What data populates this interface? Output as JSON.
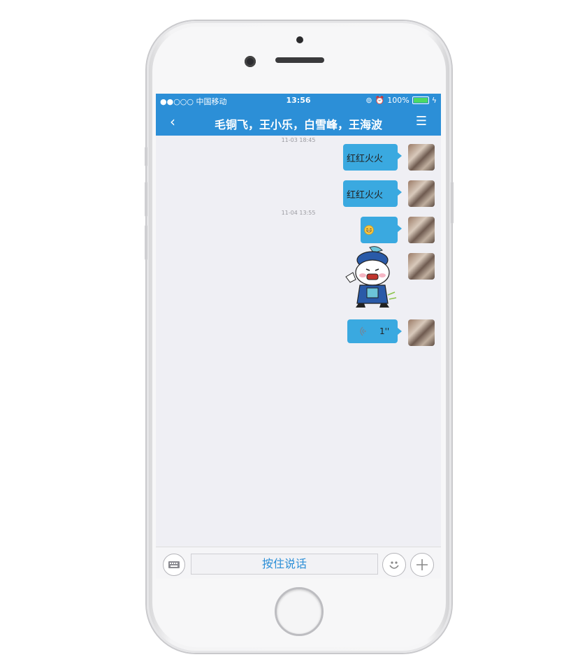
{
  "status_bar": {
    "carrier": "●●○○○ 中国移动",
    "time": "13:56",
    "battery": "100%"
  },
  "nav": {
    "title": "毛铜飞，王小乐，白雪峰，王海波",
    "back_icon": "chevron-left-icon",
    "menu_icon": "menu-icon"
  },
  "timestamps": [
    "11-03 18:45",
    "11-04 13:55"
  ],
  "messages": [
    {
      "type": "text",
      "text": "红红火火"
    },
    {
      "type": "text",
      "text": "红红火火"
    },
    {
      "type": "emoji",
      "icon": "grin-emoji-icon"
    },
    {
      "type": "sticker",
      "icon": "cartoon-official-sticker"
    },
    {
      "type": "voice",
      "duration": "1''"
    }
  ],
  "input_bar": {
    "talk_label": "按住说话",
    "keyboard_icon": "keyboard-icon",
    "emoji_icon": "smiley-icon",
    "plus_icon": "plus-icon"
  },
  "colors": {
    "accent": "#2c8fd7",
    "bubble": "#3aa9e0",
    "background": "#efeff4"
  }
}
